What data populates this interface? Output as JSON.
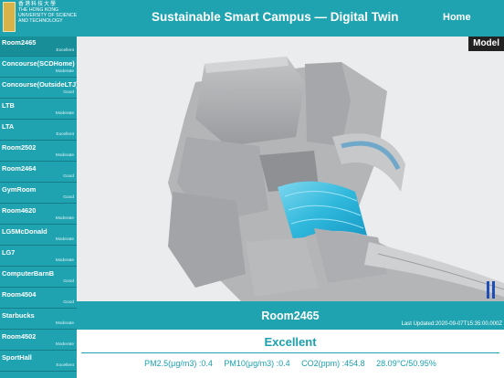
{
  "header": {
    "logo": {
      "chinese": "香港科技大學",
      "english": [
        "THE HONG KONG",
        "UNIVERSITY OF SCIENCE",
        "AND TECHNOLOGY"
      ]
    },
    "title": "Sustainable Smart Campus — Digital Twin",
    "home_label": "Home"
  },
  "sidebar": {
    "selected": "Room2465",
    "rooms": [
      {
        "name": "Room2465",
        "status": "Excellent"
      },
      {
        "name": "Concourse(SCDHome)",
        "status": "Moderate"
      },
      {
        "name": "Concourse(OutsideLTJ)",
        "status": "Good"
      },
      {
        "name": "LTB",
        "status": "Moderate"
      },
      {
        "name": "LTA",
        "status": "Excellent"
      },
      {
        "name": "Room2502",
        "status": "Moderate"
      },
      {
        "name": "Room2464",
        "status": "Good"
      },
      {
        "name": "GymRoom",
        "status": "Good"
      },
      {
        "name": "Room4620",
        "status": "Moderate"
      },
      {
        "name": "LG5McDonald",
        "status": "Moderate"
      },
      {
        "name": "LG7",
        "status": "Moderate"
      },
      {
        "name": "ComputerBarnB",
        "status": "Good"
      },
      {
        "name": "Room4504",
        "status": "Good"
      },
      {
        "name": "Starbucks",
        "status": "Moderate"
      },
      {
        "name": "Room4502",
        "status": "Moderate"
      },
      {
        "name": "SportHall",
        "status": "Excellent"
      }
    ]
  },
  "viewport": {
    "model_button": "Model",
    "pause_icon": "pause-icon",
    "highlight_color": "#2fb8dc"
  },
  "info": {
    "room": "Room2465",
    "last_updated": "Last Updated:2020-09-07T15:35:00.000Z",
    "quality": "Excellent",
    "readings": [
      "PM2.5(μg/m3) :0.4",
      "PM10(μg/m3) :0.4",
      "CO2(ppm) :454.8",
      "28.09°C/50.95%"
    ]
  },
  "colors": {
    "accent": "#1fa3b0",
    "text_accent": "#1aa1ad",
    "pause": "#1f4fb5"
  }
}
